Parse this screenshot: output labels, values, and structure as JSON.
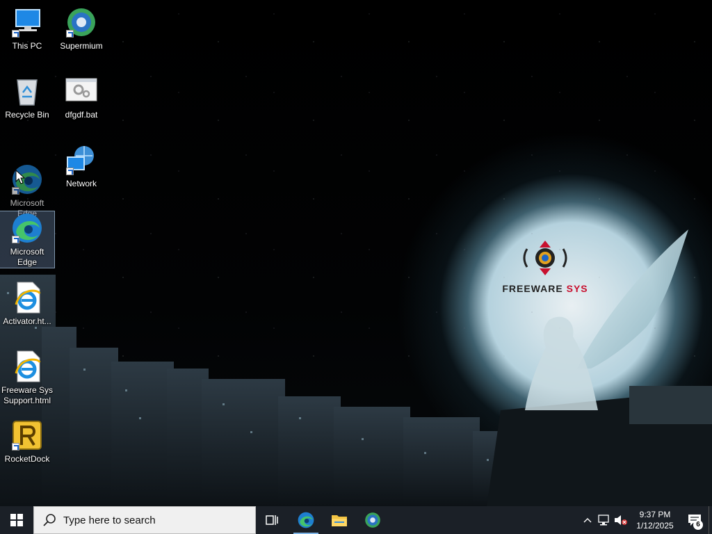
{
  "desktop": {
    "icons": [
      {
        "label": "This PC",
        "icon": "computer-icon"
      },
      {
        "label": "Supermium",
        "icon": "supermium-browser-icon"
      },
      {
        "label": "Recycle Bin",
        "icon": "recycle-bin-icon"
      },
      {
        "label": "dfgdf.bat",
        "icon": "batch-file-icon"
      },
      {
        "label": "Network",
        "icon": "network-icon"
      },
      {
        "label": "Microsoft Edge",
        "icon": "edge-icon"
      },
      {
        "label": "Microsoft Edge",
        "icon": "edge-icon",
        "selected": true
      },
      {
        "label": "Activator.ht...",
        "icon": "internet-explorer-file-icon"
      },
      {
        "label": "Freeware Sys Support.html",
        "icon": "internet-explorer-file-icon"
      },
      {
        "label": "RocketDock",
        "icon": "rocketdock-icon"
      }
    ]
  },
  "wallpaper": {
    "logo_text_main": "FREEWARE",
    "logo_text_accent": "SYS"
  },
  "taskbar": {
    "search_placeholder": "Type here to search",
    "pinned": [
      {
        "name": "task-view",
        "icon": "task-view-icon"
      },
      {
        "name": "edge",
        "icon": "edge-icon",
        "active": true
      },
      {
        "name": "file-explorer",
        "icon": "folder-icon"
      },
      {
        "name": "supermium",
        "icon": "supermium-browser-icon"
      }
    ],
    "tray": {
      "time": "9:37 PM",
      "date": "1/12/2025",
      "notification_count": "6"
    }
  },
  "colors": {
    "taskbar_bg": "#1b2027",
    "search_bg": "#f0f0f0",
    "accent": "#7fb6e8",
    "logo_accent": "#c8102e"
  }
}
